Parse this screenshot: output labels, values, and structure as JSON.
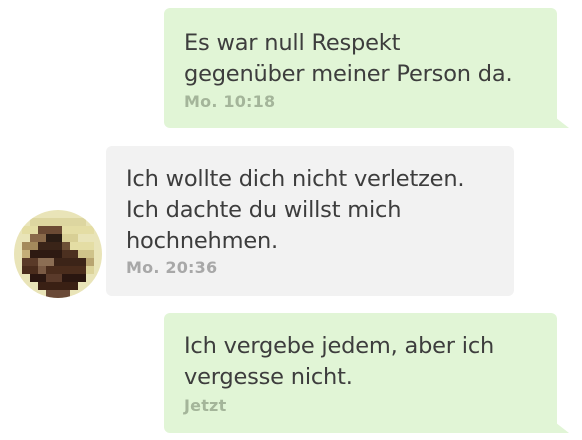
{
  "messages": [
    {
      "direction": "outgoing",
      "text": "Es war null Respekt\ngegenüber meiner Person da.",
      "time": "Mo. 10:18"
    },
    {
      "direction": "incoming",
      "text": "Ich wollte dich nicht verletzen.\nIch dachte du willst mich\nhochnehmen.",
      "time": "Mo. 20:36"
    },
    {
      "direction": "outgoing",
      "text": "Ich vergebe jedem, aber ich\nvergesse nicht.",
      "time": "Jetzt"
    }
  ],
  "colors": {
    "outgoing_bubble": "#e1f5d6",
    "incoming_bubble": "#f2f2f2",
    "text": "#3d3d3d"
  },
  "avatar": {
    "icon": "pixelated-avatar-icon"
  }
}
